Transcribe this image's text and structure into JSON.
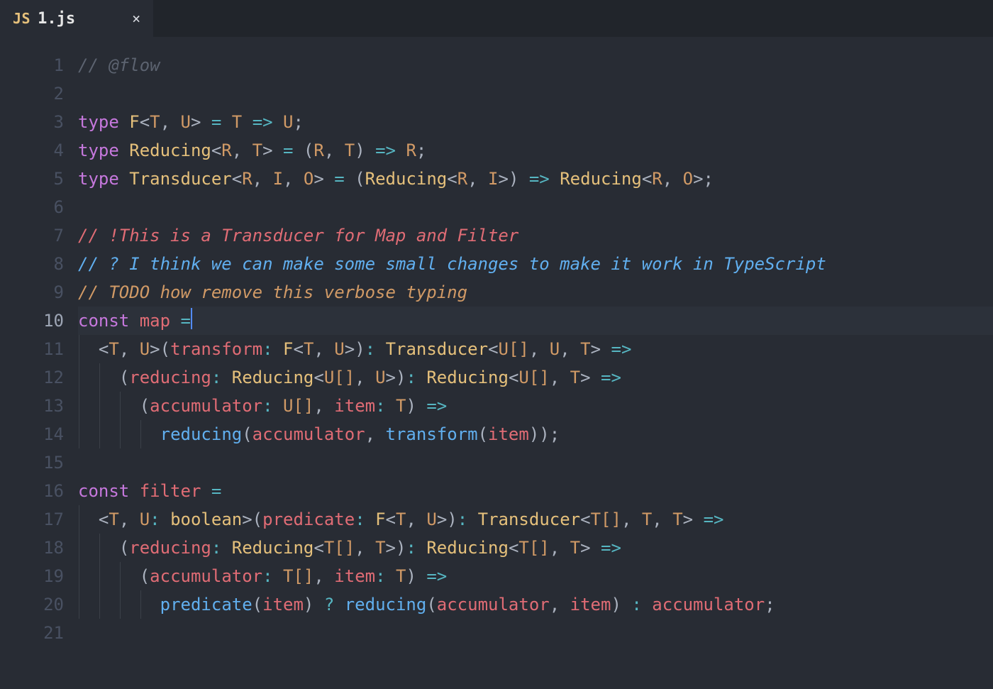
{
  "tab": {
    "icon_label": "JS",
    "filename": "1.js",
    "close_glyph": "×"
  },
  "editor": {
    "current_line": 10,
    "lines": [
      {
        "n": 1,
        "indent": 0,
        "tokens": [
          [
            "c-comment",
            "// @flow"
          ]
        ]
      },
      {
        "n": 2,
        "indent": 0,
        "tokens": []
      },
      {
        "n": 3,
        "indent": 0,
        "tokens": [
          [
            "c-kw",
            "type"
          ],
          [
            "",
            " "
          ],
          [
            "c-type",
            "F"
          ],
          [
            "c-punc",
            "<"
          ],
          [
            "c-tparam",
            "T"
          ],
          [
            "c-punc",
            ", "
          ],
          [
            "c-tparam",
            "U"
          ],
          [
            "c-punc",
            "> "
          ],
          [
            "c-op",
            "="
          ],
          [
            "",
            " "
          ],
          [
            "c-tparam",
            "T"
          ],
          [
            "",
            " "
          ],
          [
            "c-op",
            "=>"
          ],
          [
            "",
            " "
          ],
          [
            "c-tparam",
            "U"
          ],
          [
            "c-punc",
            ";"
          ]
        ]
      },
      {
        "n": 4,
        "indent": 0,
        "tokens": [
          [
            "c-kw",
            "type"
          ],
          [
            "",
            " "
          ],
          [
            "c-type",
            "Reducing"
          ],
          [
            "c-punc",
            "<"
          ],
          [
            "c-tparam",
            "R"
          ],
          [
            "c-punc",
            ", "
          ],
          [
            "c-tparam",
            "T"
          ],
          [
            "c-punc",
            "> "
          ],
          [
            "c-op",
            "="
          ],
          [
            "",
            " ("
          ],
          [
            "c-tparam",
            "R"
          ],
          [
            "c-punc",
            ", "
          ],
          [
            "c-tparam",
            "T"
          ],
          [
            "c-punc",
            ") "
          ],
          [
            "c-op",
            "=>"
          ],
          [
            "",
            " "
          ],
          [
            "c-tparam",
            "R"
          ],
          [
            "c-punc",
            ";"
          ]
        ]
      },
      {
        "n": 5,
        "indent": 0,
        "tokens": [
          [
            "c-kw",
            "type"
          ],
          [
            "",
            " "
          ],
          [
            "c-type",
            "Transducer"
          ],
          [
            "c-punc",
            "<"
          ],
          [
            "c-tparam",
            "R"
          ],
          [
            "c-punc",
            ", "
          ],
          [
            "c-tparam",
            "I"
          ],
          [
            "c-punc",
            ", "
          ],
          [
            "c-tparam",
            "O"
          ],
          [
            "c-punc",
            "> "
          ],
          [
            "c-op",
            "="
          ],
          [
            "",
            " ("
          ],
          [
            "c-type",
            "Reducing"
          ],
          [
            "c-punc",
            "<"
          ],
          [
            "c-tparam",
            "R"
          ],
          [
            "c-punc",
            ", "
          ],
          [
            "c-tparam",
            "I"
          ],
          [
            "c-punc",
            ">) "
          ],
          [
            "c-op",
            "=>"
          ],
          [
            "",
            " "
          ],
          [
            "c-type",
            "Reducing"
          ],
          [
            "c-punc",
            "<"
          ],
          [
            "c-tparam",
            "R"
          ],
          [
            "c-punc",
            ", "
          ],
          [
            "c-tparam",
            "O"
          ],
          [
            "c-punc",
            ">;"
          ]
        ]
      },
      {
        "n": 6,
        "indent": 0,
        "tokens": []
      },
      {
        "n": 7,
        "indent": 0,
        "tokens": [
          [
            "c-alert",
            "// !This is a Transducer for Map and Filter"
          ]
        ]
      },
      {
        "n": 8,
        "indent": 0,
        "tokens": [
          [
            "c-info",
            "// ? I think we can make some small changes to make it work in TypeScript"
          ]
        ]
      },
      {
        "n": 9,
        "indent": 0,
        "tokens": [
          [
            "c-todo",
            "// TODO how remove this verbose typing"
          ]
        ]
      },
      {
        "n": 10,
        "indent": 0,
        "cursor_after": true,
        "tokens": [
          [
            "c-kw",
            "const"
          ],
          [
            "",
            " "
          ],
          [
            "c-id",
            "map"
          ],
          [
            "",
            " "
          ],
          [
            "c-op",
            "="
          ]
        ]
      },
      {
        "n": 11,
        "indent": 1,
        "tokens": [
          [
            "c-punc",
            "<"
          ],
          [
            "c-tparam",
            "T"
          ],
          [
            "c-punc",
            ", "
          ],
          [
            "c-tparam",
            "U"
          ],
          [
            "c-punc",
            ">("
          ],
          [
            "c-id",
            "transform"
          ],
          [
            "c-op",
            ":"
          ],
          [
            "",
            " "
          ],
          [
            "c-type",
            "F"
          ],
          [
            "c-punc",
            "<"
          ],
          [
            "c-tparam",
            "T"
          ],
          [
            "c-punc",
            ", "
          ],
          [
            "c-tparam",
            "U"
          ],
          [
            "c-punc",
            ">)"
          ],
          [
            "c-op",
            ":"
          ],
          [
            "",
            " "
          ],
          [
            "c-type",
            "Transducer"
          ],
          [
            "c-punc",
            "<"
          ],
          [
            "c-tparam",
            "U"
          ],
          [
            "c-punc2",
            "[]"
          ],
          [
            "c-punc",
            ", "
          ],
          [
            "c-tparam",
            "U"
          ],
          [
            "c-punc",
            ", "
          ],
          [
            "c-tparam",
            "T"
          ],
          [
            "c-punc",
            "> "
          ],
          [
            "c-op",
            "=>"
          ]
        ]
      },
      {
        "n": 12,
        "indent": 2,
        "tokens": [
          [
            "c-punc",
            "("
          ],
          [
            "c-id",
            "reducing"
          ],
          [
            "c-op",
            ":"
          ],
          [
            "",
            " "
          ],
          [
            "c-type",
            "Reducing"
          ],
          [
            "c-punc",
            "<"
          ],
          [
            "c-tparam",
            "U"
          ],
          [
            "c-punc2",
            "[]"
          ],
          [
            "c-punc",
            ", "
          ],
          [
            "c-tparam",
            "U"
          ],
          [
            "c-punc",
            ">)"
          ],
          [
            "c-op",
            ":"
          ],
          [
            "",
            " "
          ],
          [
            "c-type",
            "Reducing"
          ],
          [
            "c-punc",
            "<"
          ],
          [
            "c-tparam",
            "U"
          ],
          [
            "c-punc2",
            "[]"
          ],
          [
            "c-punc",
            ", "
          ],
          [
            "c-tparam",
            "T"
          ],
          [
            "c-punc",
            "> "
          ],
          [
            "c-op",
            "=>"
          ]
        ]
      },
      {
        "n": 13,
        "indent": 3,
        "tokens": [
          [
            "c-punc",
            "("
          ],
          [
            "c-id",
            "accumulator"
          ],
          [
            "c-op",
            ":"
          ],
          [
            "",
            " "
          ],
          [
            "c-tparam",
            "U"
          ],
          [
            "c-punc2",
            "[]"
          ],
          [
            "c-punc",
            ", "
          ],
          [
            "c-id",
            "item"
          ],
          [
            "c-op",
            ":"
          ],
          [
            "",
            " "
          ],
          [
            "c-tparam",
            "T"
          ],
          [
            "c-punc",
            ") "
          ],
          [
            "c-op",
            "=>"
          ]
        ]
      },
      {
        "n": 14,
        "indent": 4,
        "tokens": [
          [
            "c-fn",
            "reducing"
          ],
          [
            "c-punc",
            "("
          ],
          [
            "c-id",
            "accumulator"
          ],
          [
            "c-punc",
            ", "
          ],
          [
            "c-fn",
            "transform"
          ],
          [
            "c-punc",
            "("
          ],
          [
            "c-id",
            "item"
          ],
          [
            "c-punc",
            "));"
          ]
        ]
      },
      {
        "n": 15,
        "indent": 0,
        "tokens": []
      },
      {
        "n": 16,
        "indent": 0,
        "tokens": [
          [
            "c-kw",
            "const"
          ],
          [
            "",
            " "
          ],
          [
            "c-id",
            "filter"
          ],
          [
            "",
            " "
          ],
          [
            "c-op",
            "="
          ]
        ]
      },
      {
        "n": 17,
        "indent": 1,
        "tokens": [
          [
            "c-punc",
            "<"
          ],
          [
            "c-tparam",
            "T"
          ],
          [
            "c-punc",
            ", "
          ],
          [
            "c-tparam",
            "U"
          ],
          [
            "c-op",
            ":"
          ],
          [
            "",
            " "
          ],
          [
            "c-type",
            "boolean"
          ],
          [
            "c-punc",
            ">("
          ],
          [
            "c-id",
            "predicate"
          ],
          [
            "c-op",
            ":"
          ],
          [
            "",
            " "
          ],
          [
            "c-type",
            "F"
          ],
          [
            "c-punc",
            "<"
          ],
          [
            "c-tparam",
            "T"
          ],
          [
            "c-punc",
            ", "
          ],
          [
            "c-tparam",
            "U"
          ],
          [
            "c-punc",
            ">)"
          ],
          [
            "c-op",
            ":"
          ],
          [
            "",
            " "
          ],
          [
            "c-type",
            "Transducer"
          ],
          [
            "c-punc",
            "<"
          ],
          [
            "c-tparam",
            "T"
          ],
          [
            "c-punc2",
            "[]"
          ],
          [
            "c-punc",
            ", "
          ],
          [
            "c-tparam",
            "T"
          ],
          [
            "c-punc",
            ", "
          ],
          [
            "c-tparam",
            "T"
          ],
          [
            "c-punc",
            "> "
          ],
          [
            "c-op",
            "=>"
          ]
        ]
      },
      {
        "n": 18,
        "indent": 2,
        "tokens": [
          [
            "c-punc",
            "("
          ],
          [
            "c-id",
            "reducing"
          ],
          [
            "c-op",
            ":"
          ],
          [
            "",
            " "
          ],
          [
            "c-type",
            "Reducing"
          ],
          [
            "c-punc",
            "<"
          ],
          [
            "c-tparam",
            "T"
          ],
          [
            "c-punc2",
            "[]"
          ],
          [
            "c-punc",
            ", "
          ],
          [
            "c-tparam",
            "T"
          ],
          [
            "c-punc",
            ">)"
          ],
          [
            "c-op",
            ":"
          ],
          [
            "",
            " "
          ],
          [
            "c-type",
            "Reducing"
          ],
          [
            "c-punc",
            "<"
          ],
          [
            "c-tparam",
            "T"
          ],
          [
            "c-punc2",
            "[]"
          ],
          [
            "c-punc",
            ", "
          ],
          [
            "c-tparam",
            "T"
          ],
          [
            "c-punc",
            "> "
          ],
          [
            "c-op",
            "=>"
          ]
        ]
      },
      {
        "n": 19,
        "indent": 3,
        "tokens": [
          [
            "c-punc",
            "("
          ],
          [
            "c-id",
            "accumulator"
          ],
          [
            "c-op",
            ":"
          ],
          [
            "",
            " "
          ],
          [
            "c-tparam",
            "T"
          ],
          [
            "c-punc2",
            "[]"
          ],
          [
            "c-punc",
            ", "
          ],
          [
            "c-id",
            "item"
          ],
          [
            "c-op",
            ":"
          ],
          [
            "",
            " "
          ],
          [
            "c-tparam",
            "T"
          ],
          [
            "c-punc",
            ") "
          ],
          [
            "c-op",
            "=>"
          ]
        ]
      },
      {
        "n": 20,
        "indent": 4,
        "tokens": [
          [
            "c-fn",
            "predicate"
          ],
          [
            "c-punc",
            "("
          ],
          [
            "c-id",
            "item"
          ],
          [
            "c-punc",
            ") "
          ],
          [
            "c-op",
            "?"
          ],
          [
            "",
            " "
          ],
          [
            "c-fn",
            "reducing"
          ],
          [
            "c-punc",
            "("
          ],
          [
            "c-id",
            "accumulator"
          ],
          [
            "c-punc",
            ", "
          ],
          [
            "c-id",
            "item"
          ],
          [
            "c-punc",
            ") "
          ],
          [
            "c-op",
            ":"
          ],
          [
            "",
            " "
          ],
          [
            "c-id",
            "accumulator"
          ],
          [
            "c-punc",
            ";"
          ]
        ]
      },
      {
        "n": 21,
        "indent": 0,
        "tokens": []
      }
    ]
  }
}
